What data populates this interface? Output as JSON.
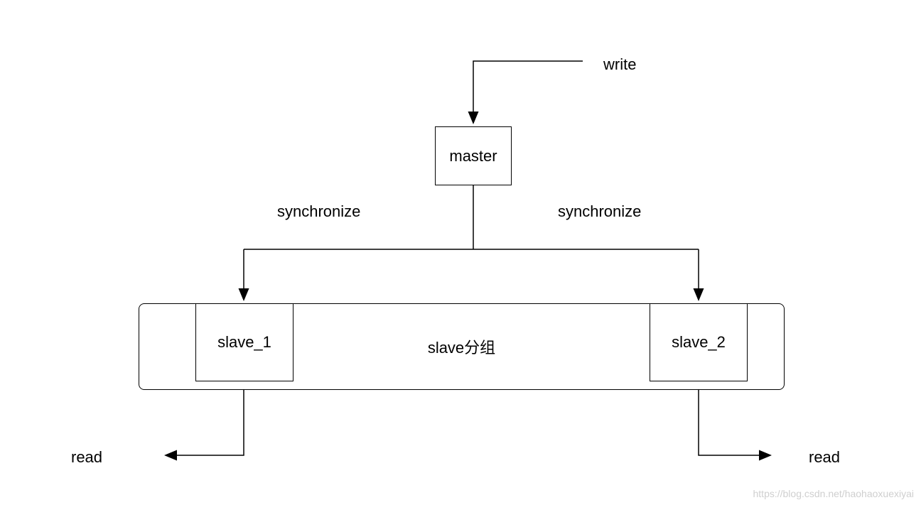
{
  "diagram": {
    "nodes": {
      "master": "master",
      "slave1": "slave_1",
      "slave2": "slave_2",
      "slave_group": "slave分组"
    },
    "labels": {
      "write": "write",
      "sync_left": "synchronize",
      "sync_right": "synchronize",
      "read_left": "read",
      "read_right": "read"
    },
    "watermark": "https://blog.csdn.net/haohaoxuexiyai"
  }
}
